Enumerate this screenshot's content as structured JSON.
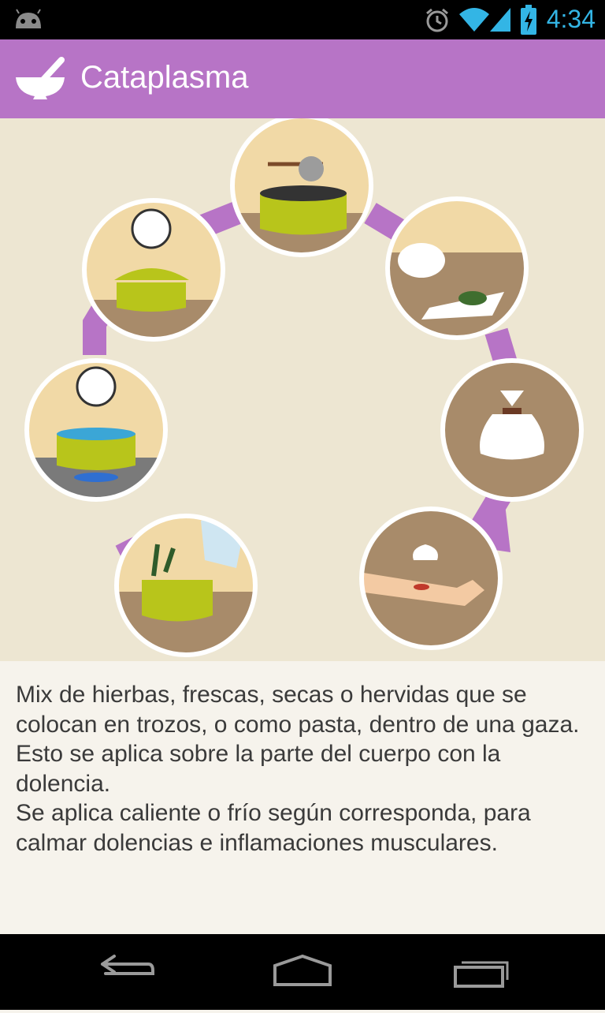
{
  "status_bar": {
    "time": "4:34"
  },
  "app": {
    "title": "Cataplasma"
  },
  "description": "Mix de hierbas, frescas, secas o hervidas que se colocan en trozos, o como pasta, dentro de una gaza. Esto se aplica sobre la parte del cuerpo con la dolencia.\nSe aplica caliente o frío según corresponda, para calmar dolencias e inflamaciones musculares.",
  "colors": {
    "action_bar": "#b774c6",
    "arrow": "#b774c6",
    "background": "#ede6d2",
    "pot": "#b8c51b"
  },
  "icons": {
    "status": [
      "android-icon",
      "alarm-icon",
      "wifi-icon",
      "signal-icon",
      "battery-icon"
    ],
    "app": "mortar-pestle-icon",
    "nav": [
      "back-icon",
      "home-icon",
      "recent-apps-icon"
    ]
  }
}
